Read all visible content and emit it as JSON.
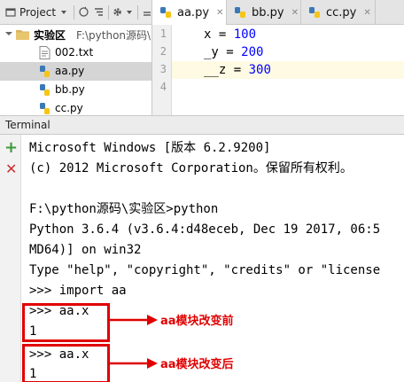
{
  "project": {
    "title": "Project",
    "root": {
      "label": "实验区",
      "path": "F:\\python源码\\实"
    },
    "files": [
      {
        "name": "002.txt",
        "type": "txt"
      },
      {
        "name": "aa.py",
        "type": "py"
      },
      {
        "name": "bb.py",
        "type": "py"
      },
      {
        "name": "cc.py",
        "type": "py"
      }
    ]
  },
  "editor": {
    "tabs": [
      {
        "label": "aa.py",
        "active": true
      },
      {
        "label": "bb.py",
        "active": false
      },
      {
        "label": "cc.py",
        "active": false
      }
    ],
    "line_numbers": [
      "1",
      "2",
      "3",
      "4"
    ],
    "code": [
      {
        "name": "x",
        "op": " = ",
        "value": "100"
      },
      {
        "name": "_y",
        "op": " = ",
        "value": "200"
      },
      {
        "name": "__z",
        "op": " = ",
        "value": "300"
      }
    ]
  },
  "terminal": {
    "title": "Terminal",
    "lines": [
      "Microsoft Windows [版本 6.2.9200]",
      "(c) 2012 Microsoft Corporation。保留所有权利。",
      "",
      "F:\\python源码\\实验区>python",
      "Python 3.6.4 (v3.6.4:d48eceb, Dec 19 2017, 06:5",
      "MD64)] on win32",
      "Type \"help\", \"copyright\", \"credits\" or \"license",
      ">>> import aa",
      ">>> aa.x",
      "1",
      ">>> aa.x",
      "1"
    ]
  },
  "annotations": {
    "before": "aa模块改变前",
    "after": "aa模块改变后"
  },
  "colors": {
    "annotation_red": "#e00000",
    "number_blue": "#0000ff",
    "current_line": "#fffae3"
  }
}
